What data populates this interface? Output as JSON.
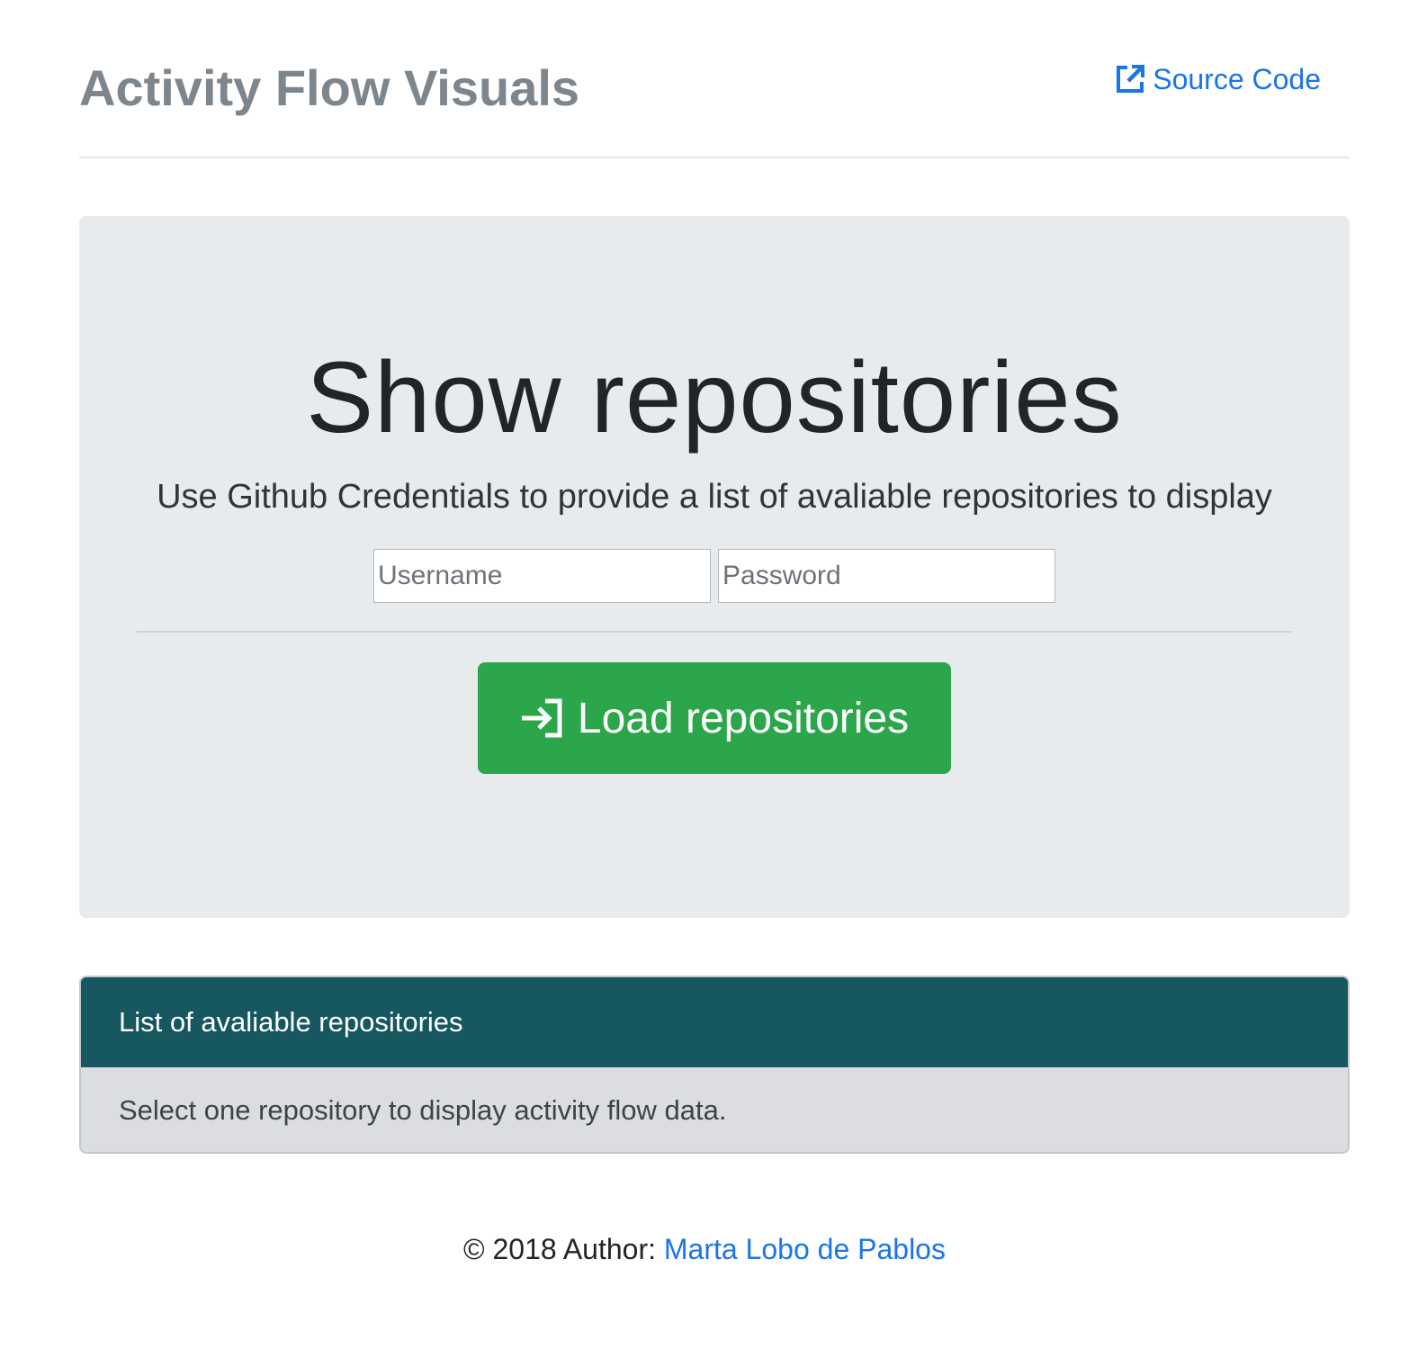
{
  "header": {
    "title": "Activity Flow Visuals",
    "source_link_label": "Source Code",
    "source_link_icon": "external-link-icon"
  },
  "hero": {
    "title": "Show repositories",
    "subtitle": "Use Github Credentials to provide a list of avaliable repositories to display",
    "username_placeholder": "Username",
    "username_value": "",
    "password_placeholder": "Password",
    "password_value": "",
    "load_button_label": "Load repositories",
    "load_button_icon": "sign-in-icon"
  },
  "repo_card": {
    "header": "List of avaliable repositories",
    "body": "Select one repository to display activity flow data."
  },
  "footer": {
    "copyright": "© 2018 Author: ",
    "author_link": "Marta Lobo de Pablos"
  },
  "colors": {
    "accent_link": "#1a75e8",
    "success_button": "#2ba64a",
    "card_header": "#165760",
    "jumbotron_bg": "#e8ebee"
  }
}
